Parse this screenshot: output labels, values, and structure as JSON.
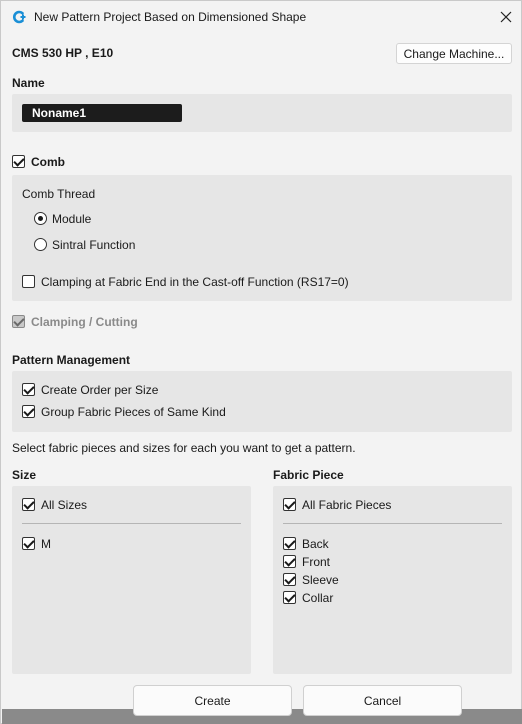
{
  "window": {
    "title": "New Pattern Project Based on Dimensioned Shape",
    "accent_color": "#0078d4"
  },
  "machine": {
    "label": "CMS 530 HP , E10",
    "change_button": "Change Machine..."
  },
  "name_section": {
    "heading": "Name",
    "value": "Noname1"
  },
  "comb": {
    "label": "Comb",
    "checked": true,
    "thread_heading": "Comb Thread",
    "options": [
      {
        "label": "Module",
        "selected": true
      },
      {
        "label": "Sintral Function",
        "selected": false
      }
    ],
    "clamping_label": "Clamping at Fabric End in the Cast-off Function (RS17=0)",
    "clamping_checked": false
  },
  "clamping_cutting": {
    "label": "Clamping / Cutting",
    "checked": true,
    "disabled": true
  },
  "pattern_management": {
    "heading": "Pattern Management",
    "items": [
      {
        "label": "Create Order per Size",
        "checked": true
      },
      {
        "label": "Group Fabric Pieces of Same Kind",
        "checked": true
      }
    ]
  },
  "instructions": "Select fabric pieces and sizes for each you want to get a pattern.",
  "size": {
    "heading": "Size",
    "all_label": "All Sizes",
    "items": [
      {
        "label": "M",
        "checked": true
      }
    ]
  },
  "fabric_piece": {
    "heading": "Fabric Piece",
    "all_label": "All Fabric Pieces",
    "items": [
      {
        "label": "Back",
        "checked": true
      },
      {
        "label": "Front",
        "checked": true
      },
      {
        "label": "Sleeve",
        "checked": true
      },
      {
        "label": "Collar",
        "checked": true
      }
    ]
  },
  "buttons": {
    "create": "Create",
    "cancel": "Cancel"
  }
}
